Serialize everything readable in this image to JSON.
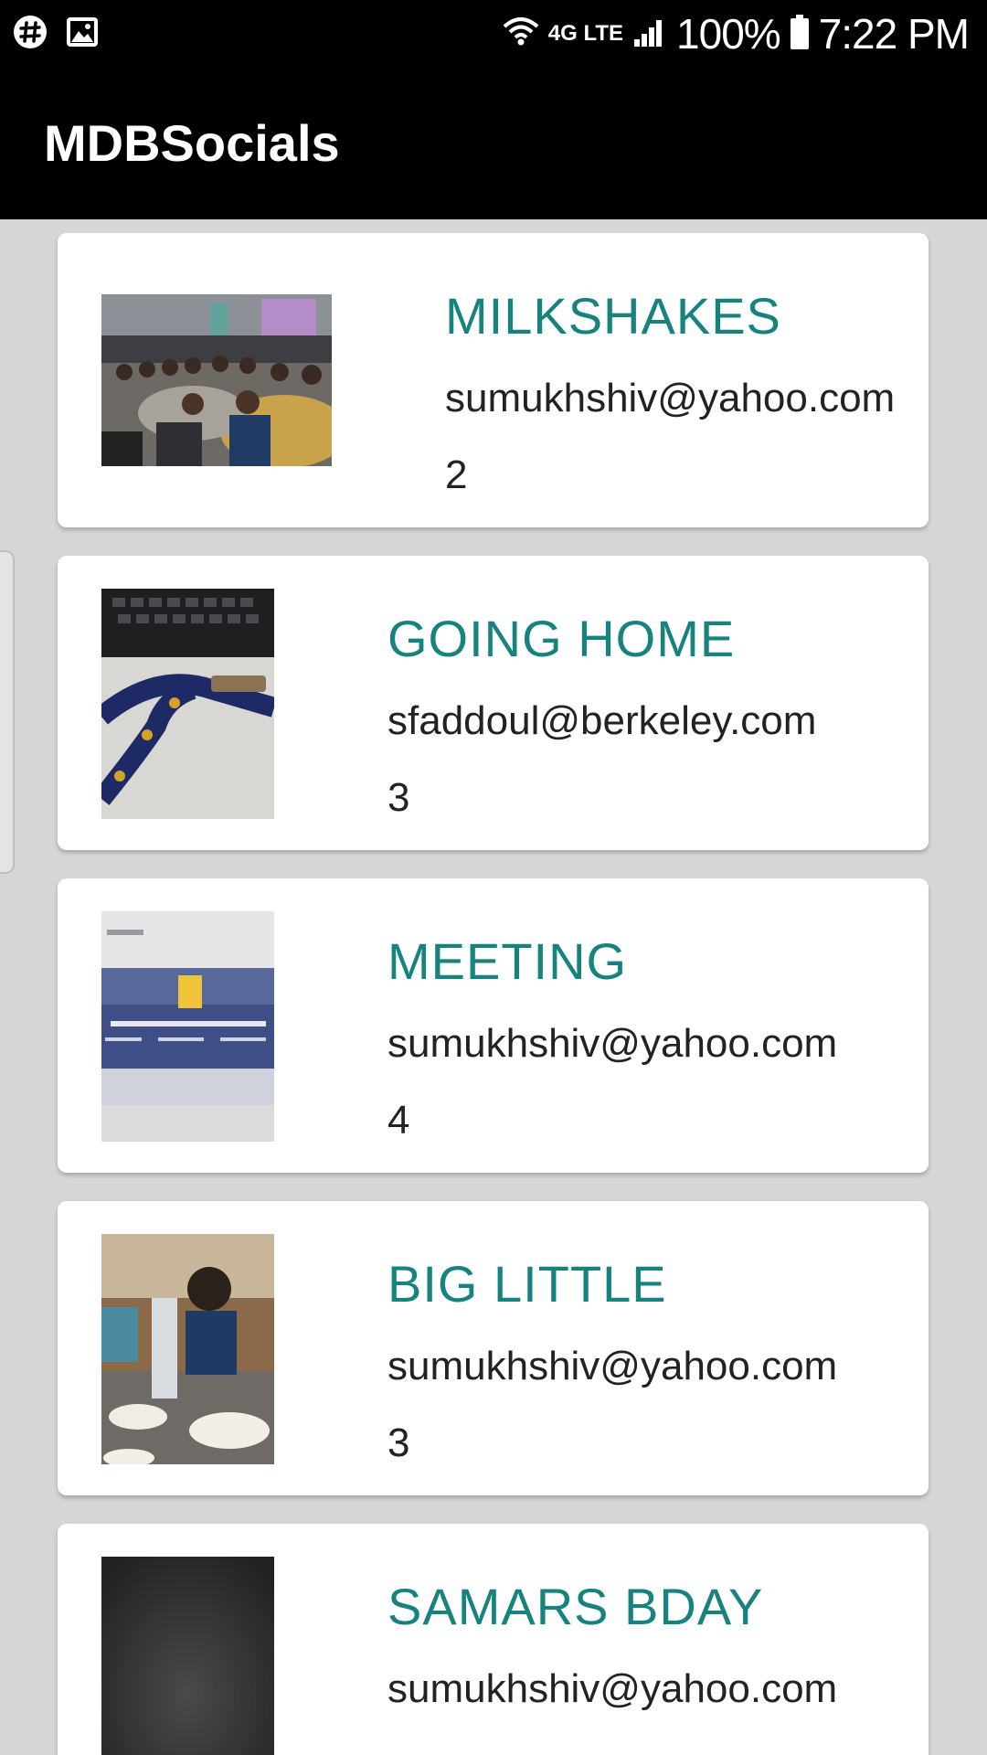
{
  "status_bar": {
    "network": "4G LTE",
    "battery": "100%",
    "time": "7:22 PM",
    "icons": [
      "slack-icon",
      "image-icon",
      "wifi-icon",
      "lte-icon",
      "signal-icon",
      "battery-icon"
    ]
  },
  "app_bar": {
    "title": "MDBSocials"
  },
  "colors": {
    "accent": "#16837f",
    "app_bar": "#000000",
    "background": "#d6d6d6",
    "card": "#ffffff"
  },
  "socials": [
    {
      "title": "MILKSHAKES",
      "email": "sumukhshiv@yahoo.com",
      "count": "2"
    },
    {
      "title": "GOING HOME",
      "email": "sfaddoul@berkeley.com",
      "count": "3"
    },
    {
      "title": "MEETING",
      "email": "sumukhshiv@yahoo.com",
      "count": "4"
    },
    {
      "title": "BIG LITTLE",
      "email": "sumukhshiv@yahoo.com",
      "count": "3"
    },
    {
      "title": "SAMARS BDAY",
      "email": "sumukhshiv@yahoo.com",
      "count": ""
    }
  ]
}
